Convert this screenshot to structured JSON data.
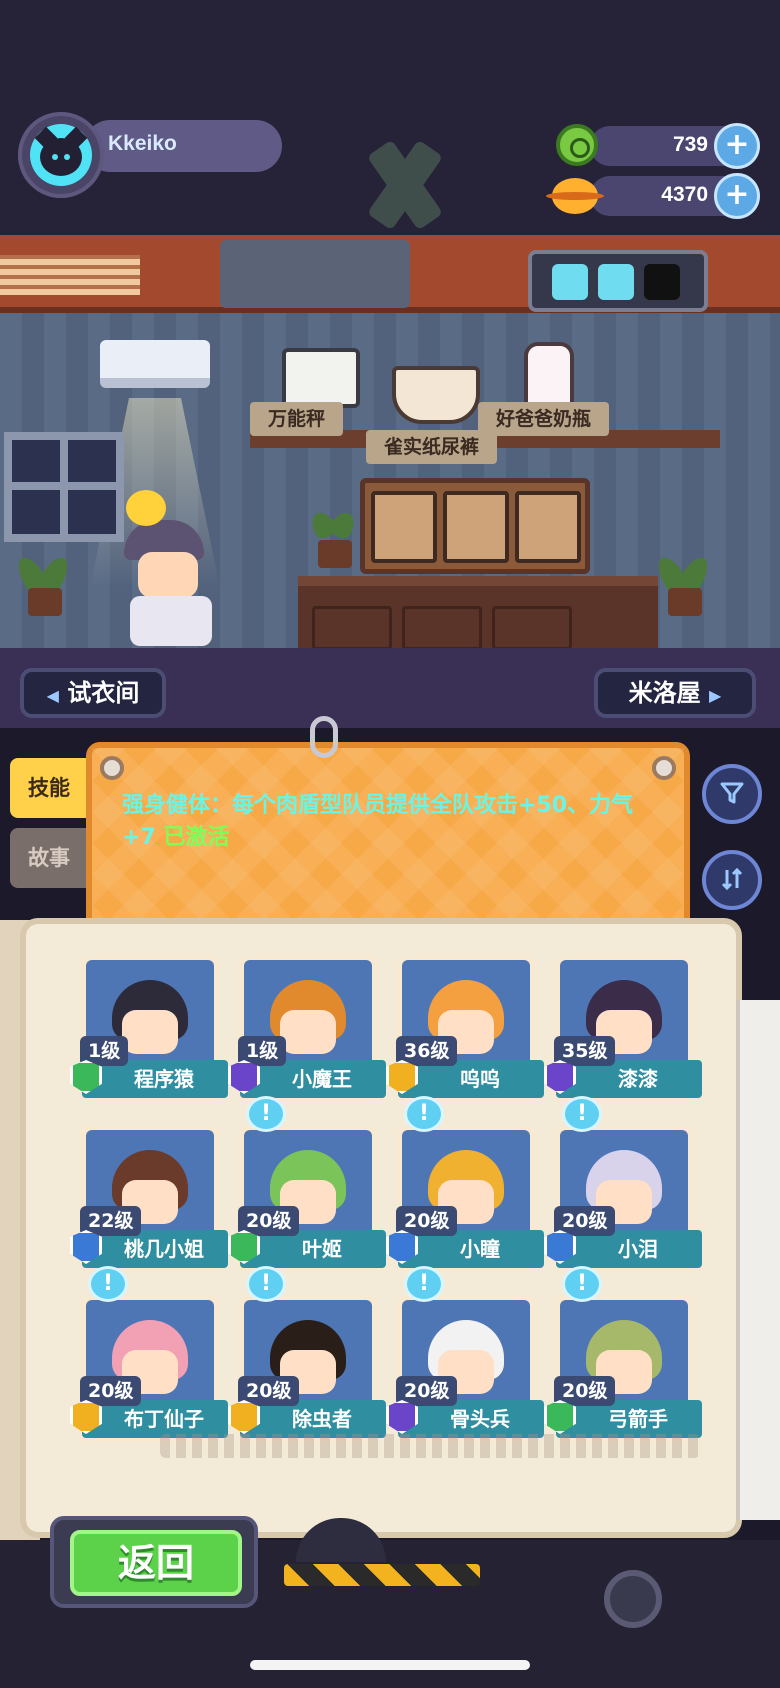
{
  "player": {
    "name": "Kkeiko",
    "avatar_icon": "cat-face-icon"
  },
  "resources": [
    {
      "name": "green-coin",
      "value": "739",
      "icon": "green-coin-icon",
      "plus": "+"
    },
    {
      "name": "orange-planet-coin",
      "value": "4370",
      "icon": "planet-coin-icon",
      "plus": "+"
    }
  ],
  "shelf_items": {
    "scale": "万能秤",
    "bottle": "好爸爸奶瓶",
    "diaper": "雀实纸尿裤"
  },
  "nav": {
    "left_label": "试衣间",
    "left_arrow": "◀",
    "right_label": "米洛屋",
    "right_arrow": "▶"
  },
  "tabs": {
    "skill": "技能",
    "story": "故事"
  },
  "skill_panel": {
    "text": "强身健体：每个肉盾型队员提供全队攻击+50、力气+7",
    "status": "已激活"
  },
  "side_buttons": {
    "filter_icon": "filter-icon",
    "sort_icon": "sort-icon"
  },
  "characters": [
    {
      "level": "1级",
      "name": "程序猿",
      "badge_color": "#3bb85a",
      "hair": "#2d2a3a",
      "bubble": false
    },
    {
      "level": "1级",
      "name": "小魔王",
      "badge_color": "#6a44c9",
      "hair": "#e08a2d",
      "bubble": false
    },
    {
      "level": "36级",
      "name": "呜呜",
      "badge_color": "#f0b020",
      "hair": "#f5a040",
      "bubble": false
    },
    {
      "level": "35级",
      "name": "漆漆",
      "badge_color": "#6a44c9",
      "hair": "#3b2d4a",
      "bubble": false
    },
    {
      "level": "22级",
      "name": "桃几小姐",
      "badge_color": "#3a7ad6",
      "hair": "#6a3a2a",
      "bubble": false
    },
    {
      "level": "20级",
      "name": "叶姬",
      "badge_color": "#3bb85a",
      "hair": "#7bc45a",
      "bubble": true
    },
    {
      "level": "20级",
      "name": "小瞳",
      "badge_color": "#3a7ad6",
      "hair": "#f0b030",
      "bubble": true
    },
    {
      "level": "20级",
      "name": "小泪",
      "badge_color": "#3a7ad6",
      "hair": "#d8d2ea",
      "bubble": true
    },
    {
      "level": "20级",
      "name": "布丁仙子",
      "badge_color": "#f0b020",
      "hair": "#f2a0b4",
      "bubble": true
    },
    {
      "level": "20级",
      "name": "除虫者",
      "badge_color": "#f0b020",
      "hair": "#2a1e18",
      "bubble": true
    },
    {
      "level": "20级",
      "name": "骨头兵",
      "badge_color": "#6a44c9",
      "hair": "#f2f2f2",
      "bubble": true
    },
    {
      "level": "20级",
      "name": "弓箭手",
      "badge_color": "#3bb85a",
      "hair": "#a6b86a",
      "bubble": true
    }
  ],
  "bubble_mark": "!",
  "footer": {
    "back_label": "返回"
  }
}
